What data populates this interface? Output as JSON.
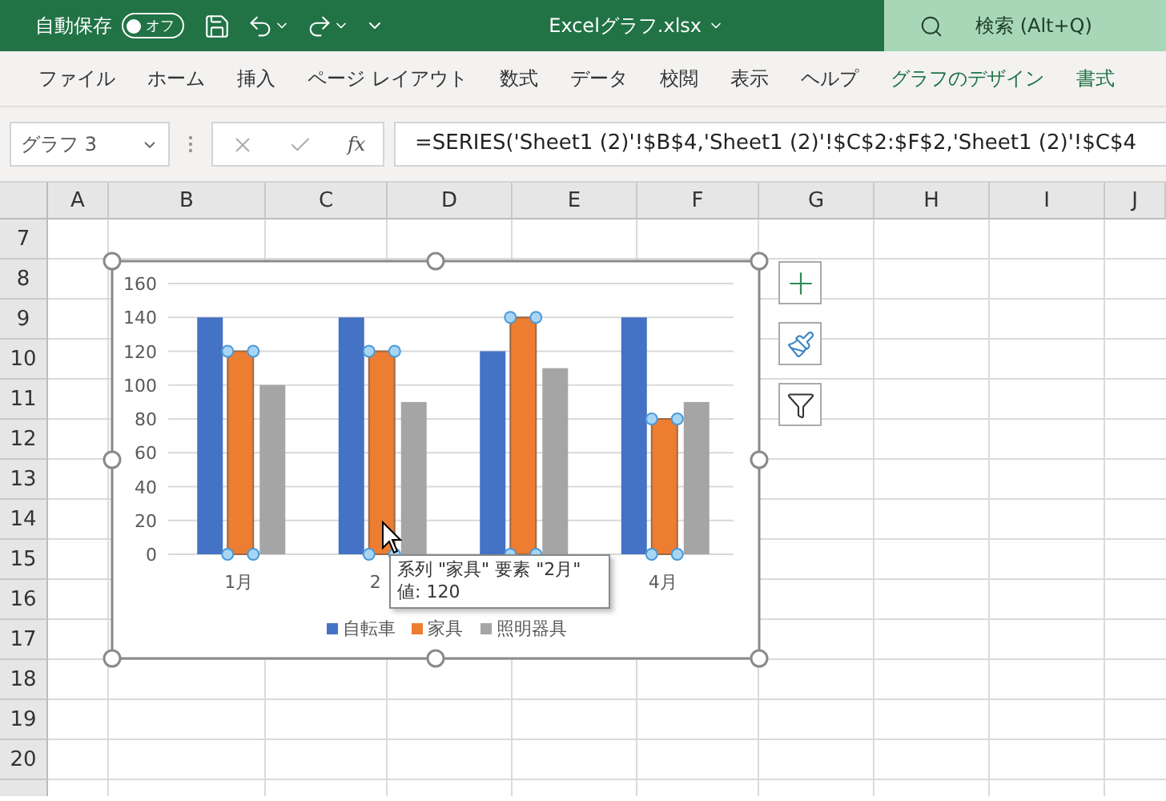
{
  "title_bar": {
    "autosave_label": "自動保存",
    "autosave_toggle": {
      "label": "オフ",
      "on": false
    },
    "file_name": "Excelグラフ.xlsx",
    "search": {
      "placeholder": "検索 (Alt+Q)"
    }
  },
  "ribbon_tabs": [
    {
      "label": "ファイル",
      "contextual": false
    },
    {
      "label": "ホーム",
      "contextual": false
    },
    {
      "label": "挿入",
      "contextual": false
    },
    {
      "label": "ページ レイアウト",
      "contextual": false
    },
    {
      "label": "数式",
      "contextual": false
    },
    {
      "label": "データ",
      "contextual": false
    },
    {
      "label": "校閲",
      "contextual": false
    },
    {
      "label": "表示",
      "contextual": false
    },
    {
      "label": "ヘルプ",
      "contextual": false
    },
    {
      "label": "グラフのデザイン",
      "contextual": true
    },
    {
      "label": "書式",
      "contextual": true
    }
  ],
  "formula_bar": {
    "name_box": "グラフ 3",
    "function_label": "fx",
    "formula": "=SERIES('Sheet1 (2)'!$B$4,'Sheet1 (2)'!$C$2:$F$2,'Sheet1 (2)'!$C$4"
  },
  "columns": [
    "A",
    "B",
    "C",
    "D",
    "E",
    "F",
    "G",
    "H",
    "I",
    "J"
  ],
  "rows": [
    "7",
    "8",
    "9",
    "10",
    "11",
    "12",
    "13",
    "14",
    "15",
    "16",
    "17",
    "18",
    "19",
    "20"
  ],
  "chart": {
    "selected": true,
    "series_selection": [
      false,
      true,
      false
    ],
    "chart_data": {
      "type": "bar",
      "grid": true,
      "legend": true,
      "categories": [
        "1月",
        "2",
        null,
        "4月"
      ],
      "ylim": [
        0,
        160
      ],
      "yticks": [
        0,
        20,
        40,
        60,
        80,
        100,
        120,
        140,
        160
      ],
      "series": [
        {
          "name": "自転車",
          "color": "#4472c4",
          "values": [
            140,
            140,
            120,
            140
          ]
        },
        {
          "name": "家具",
          "color": "#ed7d31",
          "values": [
            120,
            120,
            140,
            80
          ]
        },
        {
          "name": "照明器具",
          "color": "#a5a5a5",
          "values": [
            100,
            90,
            110,
            90
          ]
        }
      ]
    },
    "tooltip": {
      "line_1": "系列 \"家具\" 要素 \"2月\"",
      "line_2": "値: 120"
    }
  }
}
